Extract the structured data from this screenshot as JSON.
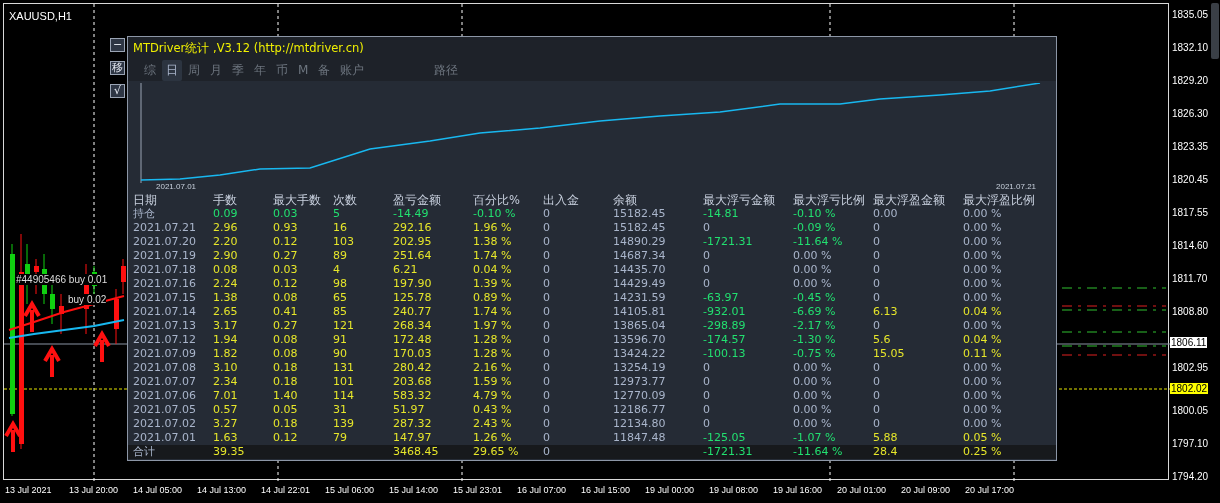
{
  "symbol": "XAUUSD,H1",
  "side_buttons": [
    "−",
    "移",
    "√"
  ],
  "trade_labels": [
    "#44905466 buy 0.01",
    "buy 0.02"
  ],
  "panel": {
    "title": "MTDriver统计 ,V3.12 (http://mtdriver.cn)",
    "tabs": [
      {
        "label": "综",
        "selected": false
      },
      {
        "label": "日",
        "selected": true
      },
      {
        "label": "周",
        "selected": false
      },
      {
        "label": "月",
        "selected": false
      },
      {
        "label": "季",
        "selected": false
      },
      {
        "label": "年",
        "selected": false
      },
      {
        "label": "币",
        "selected": false
      },
      {
        "label": "M",
        "selected": false
      },
      {
        "label": "备",
        "selected": false
      },
      {
        "label": "账户",
        "selected": false
      },
      {
        "label": "路径",
        "selected": false
      }
    ],
    "equity_chart": {
      "start_label": "2021.07.01",
      "end_label": "2021.07.21"
    },
    "columns": [
      "日期",
      "手数",
      "最大手数",
      "次数",
      "盈亏金额",
      "百分比%",
      "出入金",
      "余额",
      "最大浮亏金额",
      "最大浮亏比例",
      "最大浮盈金额",
      "最大浮盈比例"
    ],
    "rows": [
      {
        "kind": "open",
        "cells": [
          {
            "text": "持仓",
            "kind": "plain"
          },
          {
            "text": "0.09",
            "kind": "loss"
          },
          {
            "text": "0.03",
            "kind": "loss"
          },
          {
            "text": "5",
            "kind": "loss"
          },
          {
            "text": "-14.49",
            "kind": "loss"
          },
          {
            "text": "-0.10 %",
            "kind": "loss"
          },
          {
            "text": "0",
            "kind": "plain"
          },
          {
            "text": "15182.45",
            "kind": "plain"
          },
          {
            "text": "-14.81",
            "kind": "loss"
          },
          {
            "text": "-0.10 %",
            "kind": "loss"
          },
          {
            "text": "0.00",
            "kind": "plain"
          },
          {
            "text": "0.00 %",
            "kind": "plain"
          }
        ]
      },
      {
        "kind": "day",
        "cells": [
          {
            "text": "2021.07.21",
            "kind": "plain"
          },
          {
            "text": "2.96",
            "kind": "gain"
          },
          {
            "text": "0.93",
            "kind": "gain"
          },
          {
            "text": "16",
            "kind": "gain"
          },
          {
            "text": "292.16",
            "kind": "gain"
          },
          {
            "text": "1.96 %",
            "kind": "gain"
          },
          {
            "text": "0",
            "kind": "plain"
          },
          {
            "text": "15182.45",
            "kind": "plain"
          },
          {
            "text": "0",
            "kind": "plain"
          },
          {
            "text": "-0.09 %",
            "kind": "loss"
          },
          {
            "text": "0",
            "kind": "plain"
          },
          {
            "text": "0.00 %",
            "kind": "plain"
          }
        ]
      },
      {
        "kind": "day",
        "cells": [
          {
            "text": "2021.07.20",
            "kind": "plain"
          },
          {
            "text": "2.20",
            "kind": "gain"
          },
          {
            "text": "0.12",
            "kind": "gain"
          },
          {
            "text": "103",
            "kind": "gain"
          },
          {
            "text": "202.95",
            "kind": "gain"
          },
          {
            "text": "1.38 %",
            "kind": "gain"
          },
          {
            "text": "0",
            "kind": "plain"
          },
          {
            "text": "14890.29",
            "kind": "plain"
          },
          {
            "text": "-1721.31",
            "kind": "loss"
          },
          {
            "text": "-11.64 %",
            "kind": "loss"
          },
          {
            "text": "0",
            "kind": "plain"
          },
          {
            "text": "0.00 %",
            "kind": "plain"
          }
        ]
      },
      {
        "kind": "day",
        "cells": [
          {
            "text": "2021.07.19",
            "kind": "plain"
          },
          {
            "text": "2.90",
            "kind": "gain"
          },
          {
            "text": "0.27",
            "kind": "gain"
          },
          {
            "text": "89",
            "kind": "gain"
          },
          {
            "text": "251.64",
            "kind": "gain"
          },
          {
            "text": "1.74 %",
            "kind": "gain"
          },
          {
            "text": "0",
            "kind": "plain"
          },
          {
            "text": "14687.34",
            "kind": "plain"
          },
          {
            "text": "0",
            "kind": "plain"
          },
          {
            "text": "0.00 %",
            "kind": "plain"
          },
          {
            "text": "0",
            "kind": "plain"
          },
          {
            "text": "0.00 %",
            "kind": "plain"
          }
        ]
      },
      {
        "kind": "day",
        "cells": [
          {
            "text": "2021.07.18",
            "kind": "plain"
          },
          {
            "text": "0.08",
            "kind": "gain"
          },
          {
            "text": "0.03",
            "kind": "gain"
          },
          {
            "text": "4",
            "kind": "gain"
          },
          {
            "text": "6.21",
            "kind": "gain"
          },
          {
            "text": "0.04 %",
            "kind": "gain"
          },
          {
            "text": "0",
            "kind": "plain"
          },
          {
            "text": "14435.70",
            "kind": "plain"
          },
          {
            "text": "0",
            "kind": "plain"
          },
          {
            "text": "0.00 %",
            "kind": "plain"
          },
          {
            "text": "0",
            "kind": "plain"
          },
          {
            "text": "0.00 %",
            "kind": "plain"
          }
        ]
      },
      {
        "kind": "day",
        "cells": [
          {
            "text": "2021.07.16",
            "kind": "plain"
          },
          {
            "text": "2.24",
            "kind": "gain"
          },
          {
            "text": "0.12",
            "kind": "gain"
          },
          {
            "text": "98",
            "kind": "gain"
          },
          {
            "text": "197.90",
            "kind": "gain"
          },
          {
            "text": "1.39 %",
            "kind": "gain"
          },
          {
            "text": "0",
            "kind": "plain"
          },
          {
            "text": "14429.49",
            "kind": "plain"
          },
          {
            "text": "0",
            "kind": "plain"
          },
          {
            "text": "0.00 %",
            "kind": "plain"
          },
          {
            "text": "0",
            "kind": "plain"
          },
          {
            "text": "0.00 %",
            "kind": "plain"
          }
        ]
      },
      {
        "kind": "day",
        "cells": [
          {
            "text": "2021.07.15",
            "kind": "plain"
          },
          {
            "text": "1.38",
            "kind": "gain"
          },
          {
            "text": "0.08",
            "kind": "gain"
          },
          {
            "text": "65",
            "kind": "gain"
          },
          {
            "text": "125.78",
            "kind": "gain"
          },
          {
            "text": "0.89 %",
            "kind": "gain"
          },
          {
            "text": "0",
            "kind": "plain"
          },
          {
            "text": "14231.59",
            "kind": "plain"
          },
          {
            "text": "-63.97",
            "kind": "loss"
          },
          {
            "text": "-0.45 %",
            "kind": "loss"
          },
          {
            "text": "0",
            "kind": "plain"
          },
          {
            "text": "0.00 %",
            "kind": "plain"
          }
        ]
      },
      {
        "kind": "day",
        "cells": [
          {
            "text": "2021.07.14",
            "kind": "plain"
          },
          {
            "text": "2.65",
            "kind": "gain"
          },
          {
            "text": "0.41",
            "kind": "gain"
          },
          {
            "text": "85",
            "kind": "gain"
          },
          {
            "text": "240.77",
            "kind": "gain"
          },
          {
            "text": "1.74 %",
            "kind": "gain"
          },
          {
            "text": "0",
            "kind": "plain"
          },
          {
            "text": "14105.81",
            "kind": "plain"
          },
          {
            "text": "-932.01",
            "kind": "loss"
          },
          {
            "text": "-6.69 %",
            "kind": "loss"
          },
          {
            "text": "6.13",
            "kind": "gain"
          },
          {
            "text": "0.04 %",
            "kind": "gain"
          }
        ]
      },
      {
        "kind": "day",
        "cells": [
          {
            "text": "2021.07.13",
            "kind": "plain"
          },
          {
            "text": "3.17",
            "kind": "gain"
          },
          {
            "text": "0.27",
            "kind": "gain"
          },
          {
            "text": "121",
            "kind": "gain"
          },
          {
            "text": "268.34",
            "kind": "gain"
          },
          {
            "text": "1.97 %",
            "kind": "gain"
          },
          {
            "text": "0",
            "kind": "plain"
          },
          {
            "text": "13865.04",
            "kind": "plain"
          },
          {
            "text": "-298.89",
            "kind": "loss"
          },
          {
            "text": "-2.17 %",
            "kind": "loss"
          },
          {
            "text": "0",
            "kind": "plain"
          },
          {
            "text": "0.00 %",
            "kind": "plain"
          }
        ]
      },
      {
        "kind": "day",
        "cells": [
          {
            "text": "2021.07.12",
            "kind": "plain"
          },
          {
            "text": "1.94",
            "kind": "gain"
          },
          {
            "text": "0.08",
            "kind": "gain"
          },
          {
            "text": "91",
            "kind": "gain"
          },
          {
            "text": "172.48",
            "kind": "gain"
          },
          {
            "text": "1.28 %",
            "kind": "gain"
          },
          {
            "text": "0",
            "kind": "plain"
          },
          {
            "text": "13596.70",
            "kind": "plain"
          },
          {
            "text": "-174.57",
            "kind": "loss"
          },
          {
            "text": "-1.30 %",
            "kind": "loss"
          },
          {
            "text": "5.6",
            "kind": "gain"
          },
          {
            "text": "0.04 %",
            "kind": "gain"
          }
        ]
      },
      {
        "kind": "day",
        "cells": [
          {
            "text": "2021.07.09",
            "kind": "plain"
          },
          {
            "text": "1.82",
            "kind": "gain"
          },
          {
            "text": "0.08",
            "kind": "gain"
          },
          {
            "text": "90",
            "kind": "gain"
          },
          {
            "text": "170.03",
            "kind": "gain"
          },
          {
            "text": "1.28 %",
            "kind": "gain"
          },
          {
            "text": "0",
            "kind": "plain"
          },
          {
            "text": "13424.22",
            "kind": "plain"
          },
          {
            "text": "-100.13",
            "kind": "loss"
          },
          {
            "text": "-0.75 %",
            "kind": "loss"
          },
          {
            "text": "15.05",
            "kind": "gain"
          },
          {
            "text": "0.11 %",
            "kind": "gain"
          }
        ]
      },
      {
        "kind": "day",
        "cells": [
          {
            "text": "2021.07.08",
            "kind": "plain"
          },
          {
            "text": "3.10",
            "kind": "gain"
          },
          {
            "text": "0.18",
            "kind": "gain"
          },
          {
            "text": "131",
            "kind": "gain"
          },
          {
            "text": "280.42",
            "kind": "gain"
          },
          {
            "text": "2.16 %",
            "kind": "gain"
          },
          {
            "text": "0",
            "kind": "plain"
          },
          {
            "text": "13254.19",
            "kind": "plain"
          },
          {
            "text": "0",
            "kind": "plain"
          },
          {
            "text": "0.00 %",
            "kind": "plain"
          },
          {
            "text": "0",
            "kind": "plain"
          },
          {
            "text": "0.00 %",
            "kind": "plain"
          }
        ]
      },
      {
        "kind": "day",
        "cells": [
          {
            "text": "2021.07.07",
            "kind": "plain"
          },
          {
            "text": "2.34",
            "kind": "gain"
          },
          {
            "text": "0.18",
            "kind": "gain"
          },
          {
            "text": "101",
            "kind": "gain"
          },
          {
            "text": "203.68",
            "kind": "gain"
          },
          {
            "text": "1.59 %",
            "kind": "gain"
          },
          {
            "text": "0",
            "kind": "plain"
          },
          {
            "text": "12973.77",
            "kind": "plain"
          },
          {
            "text": "0",
            "kind": "plain"
          },
          {
            "text": "0.00 %",
            "kind": "plain"
          },
          {
            "text": "0",
            "kind": "plain"
          },
          {
            "text": "0.00 %",
            "kind": "plain"
          }
        ]
      },
      {
        "kind": "day",
        "cells": [
          {
            "text": "2021.07.06",
            "kind": "plain"
          },
          {
            "text": "7.01",
            "kind": "gain"
          },
          {
            "text": "1.40",
            "kind": "gain"
          },
          {
            "text": "114",
            "kind": "gain"
          },
          {
            "text": "583.32",
            "kind": "gain"
          },
          {
            "text": "4.79 %",
            "kind": "gain"
          },
          {
            "text": "0",
            "kind": "plain"
          },
          {
            "text": "12770.09",
            "kind": "plain"
          },
          {
            "text": "0",
            "kind": "plain"
          },
          {
            "text": "0.00 %",
            "kind": "plain"
          },
          {
            "text": "0",
            "kind": "plain"
          },
          {
            "text": "0.00 %",
            "kind": "plain"
          }
        ]
      },
      {
        "kind": "day",
        "cells": [
          {
            "text": "2021.07.05",
            "kind": "plain"
          },
          {
            "text": "0.57",
            "kind": "gain"
          },
          {
            "text": "0.05",
            "kind": "gain"
          },
          {
            "text": "31",
            "kind": "gain"
          },
          {
            "text": "51.97",
            "kind": "gain"
          },
          {
            "text": "0.43 %",
            "kind": "gain"
          },
          {
            "text": "0",
            "kind": "plain"
          },
          {
            "text": "12186.77",
            "kind": "plain"
          },
          {
            "text": "0",
            "kind": "plain"
          },
          {
            "text": "0.00 %",
            "kind": "plain"
          },
          {
            "text": "0",
            "kind": "plain"
          },
          {
            "text": "0.00 %",
            "kind": "plain"
          }
        ]
      },
      {
        "kind": "day",
        "cells": [
          {
            "text": "2021.07.02",
            "kind": "plain"
          },
          {
            "text": "3.27",
            "kind": "gain"
          },
          {
            "text": "0.18",
            "kind": "gain"
          },
          {
            "text": "139",
            "kind": "gain"
          },
          {
            "text": "287.32",
            "kind": "gain"
          },
          {
            "text": "2.43 %",
            "kind": "gain"
          },
          {
            "text": "0",
            "kind": "plain"
          },
          {
            "text": "12134.80",
            "kind": "plain"
          },
          {
            "text": "0",
            "kind": "plain"
          },
          {
            "text": "0.00 %",
            "kind": "plain"
          },
          {
            "text": "0",
            "kind": "plain"
          },
          {
            "text": "0.00 %",
            "kind": "plain"
          }
        ]
      },
      {
        "kind": "day",
        "cells": [
          {
            "text": "2021.07.01",
            "kind": "plain"
          },
          {
            "text": "1.63",
            "kind": "gain"
          },
          {
            "text": "0.12",
            "kind": "gain"
          },
          {
            "text": "79",
            "kind": "gain"
          },
          {
            "text": "147.97",
            "kind": "gain"
          },
          {
            "text": "1.26 %",
            "kind": "gain"
          },
          {
            "text": "0",
            "kind": "plain"
          },
          {
            "text": "11847.48",
            "kind": "plain"
          },
          {
            "text": "-125.05",
            "kind": "loss"
          },
          {
            "text": "-1.07 %",
            "kind": "loss"
          },
          {
            "text": "5.88",
            "kind": "gain"
          },
          {
            "text": "0.05 %",
            "kind": "gain"
          }
        ]
      },
      {
        "kind": "total",
        "cells": [
          {
            "text": "合计",
            "kind": "plain"
          },
          {
            "text": "39.35",
            "kind": "gain"
          },
          null,
          null,
          {
            "text": "3468.45",
            "kind": "gain"
          },
          {
            "text": "29.65 %",
            "kind": "gain"
          },
          {
            "text": "0",
            "kind": "plain"
          },
          null,
          {
            "text": "-1721.31",
            "kind": "loss"
          },
          {
            "text": "-11.64 %",
            "kind": "loss"
          },
          {
            "text": "28.4",
            "kind": "gain"
          },
          {
            "text": "0.25 %",
            "kind": "gain"
          }
        ]
      }
    ]
  },
  "price_axis": [
    {
      "label": "1835.05",
      "kind": "tick"
    },
    {
      "label": "1832.10",
      "kind": "tick"
    },
    {
      "label": "1829.20",
      "kind": "tick"
    },
    {
      "label": "1826.30",
      "kind": "tick"
    },
    {
      "label": "1823.35",
      "kind": "tick"
    },
    {
      "label": "1820.45",
      "kind": "tick"
    },
    {
      "label": "1817.55",
      "kind": "tick"
    },
    {
      "label": "1814.60",
      "kind": "tick"
    },
    {
      "label": "1811.70",
      "kind": "tick"
    },
    {
      "label": "1808.80",
      "kind": "tick"
    },
    {
      "label": "1806.11",
      "kind": "bid"
    },
    {
      "label": "1802.95",
      "kind": "tick"
    },
    {
      "label": "1802.02",
      "kind": "ask"
    },
    {
      "label": "1800.05",
      "kind": "tick"
    },
    {
      "label": "1797.10",
      "kind": "tick"
    },
    {
      "label": "1794.20",
      "kind": "tick"
    }
  ],
  "time_axis": [
    "13 Jul 2021",
    "13 Jul 20:00",
    "14 Jul 05:00",
    "14 Jul 13:00",
    "14 Jul 22:01",
    "15 Jul 06:00",
    "15 Jul 14:00",
    "15 Jul 23:01",
    "16 Jul 07:00",
    "16 Jul 15:00",
    "19 Jul 00:00",
    "19 Jul 08:00",
    "19 Jul 16:00",
    "20 Jul 01:00",
    "20 Jul 09:00",
    "20 Jul 17:00"
  ]
}
